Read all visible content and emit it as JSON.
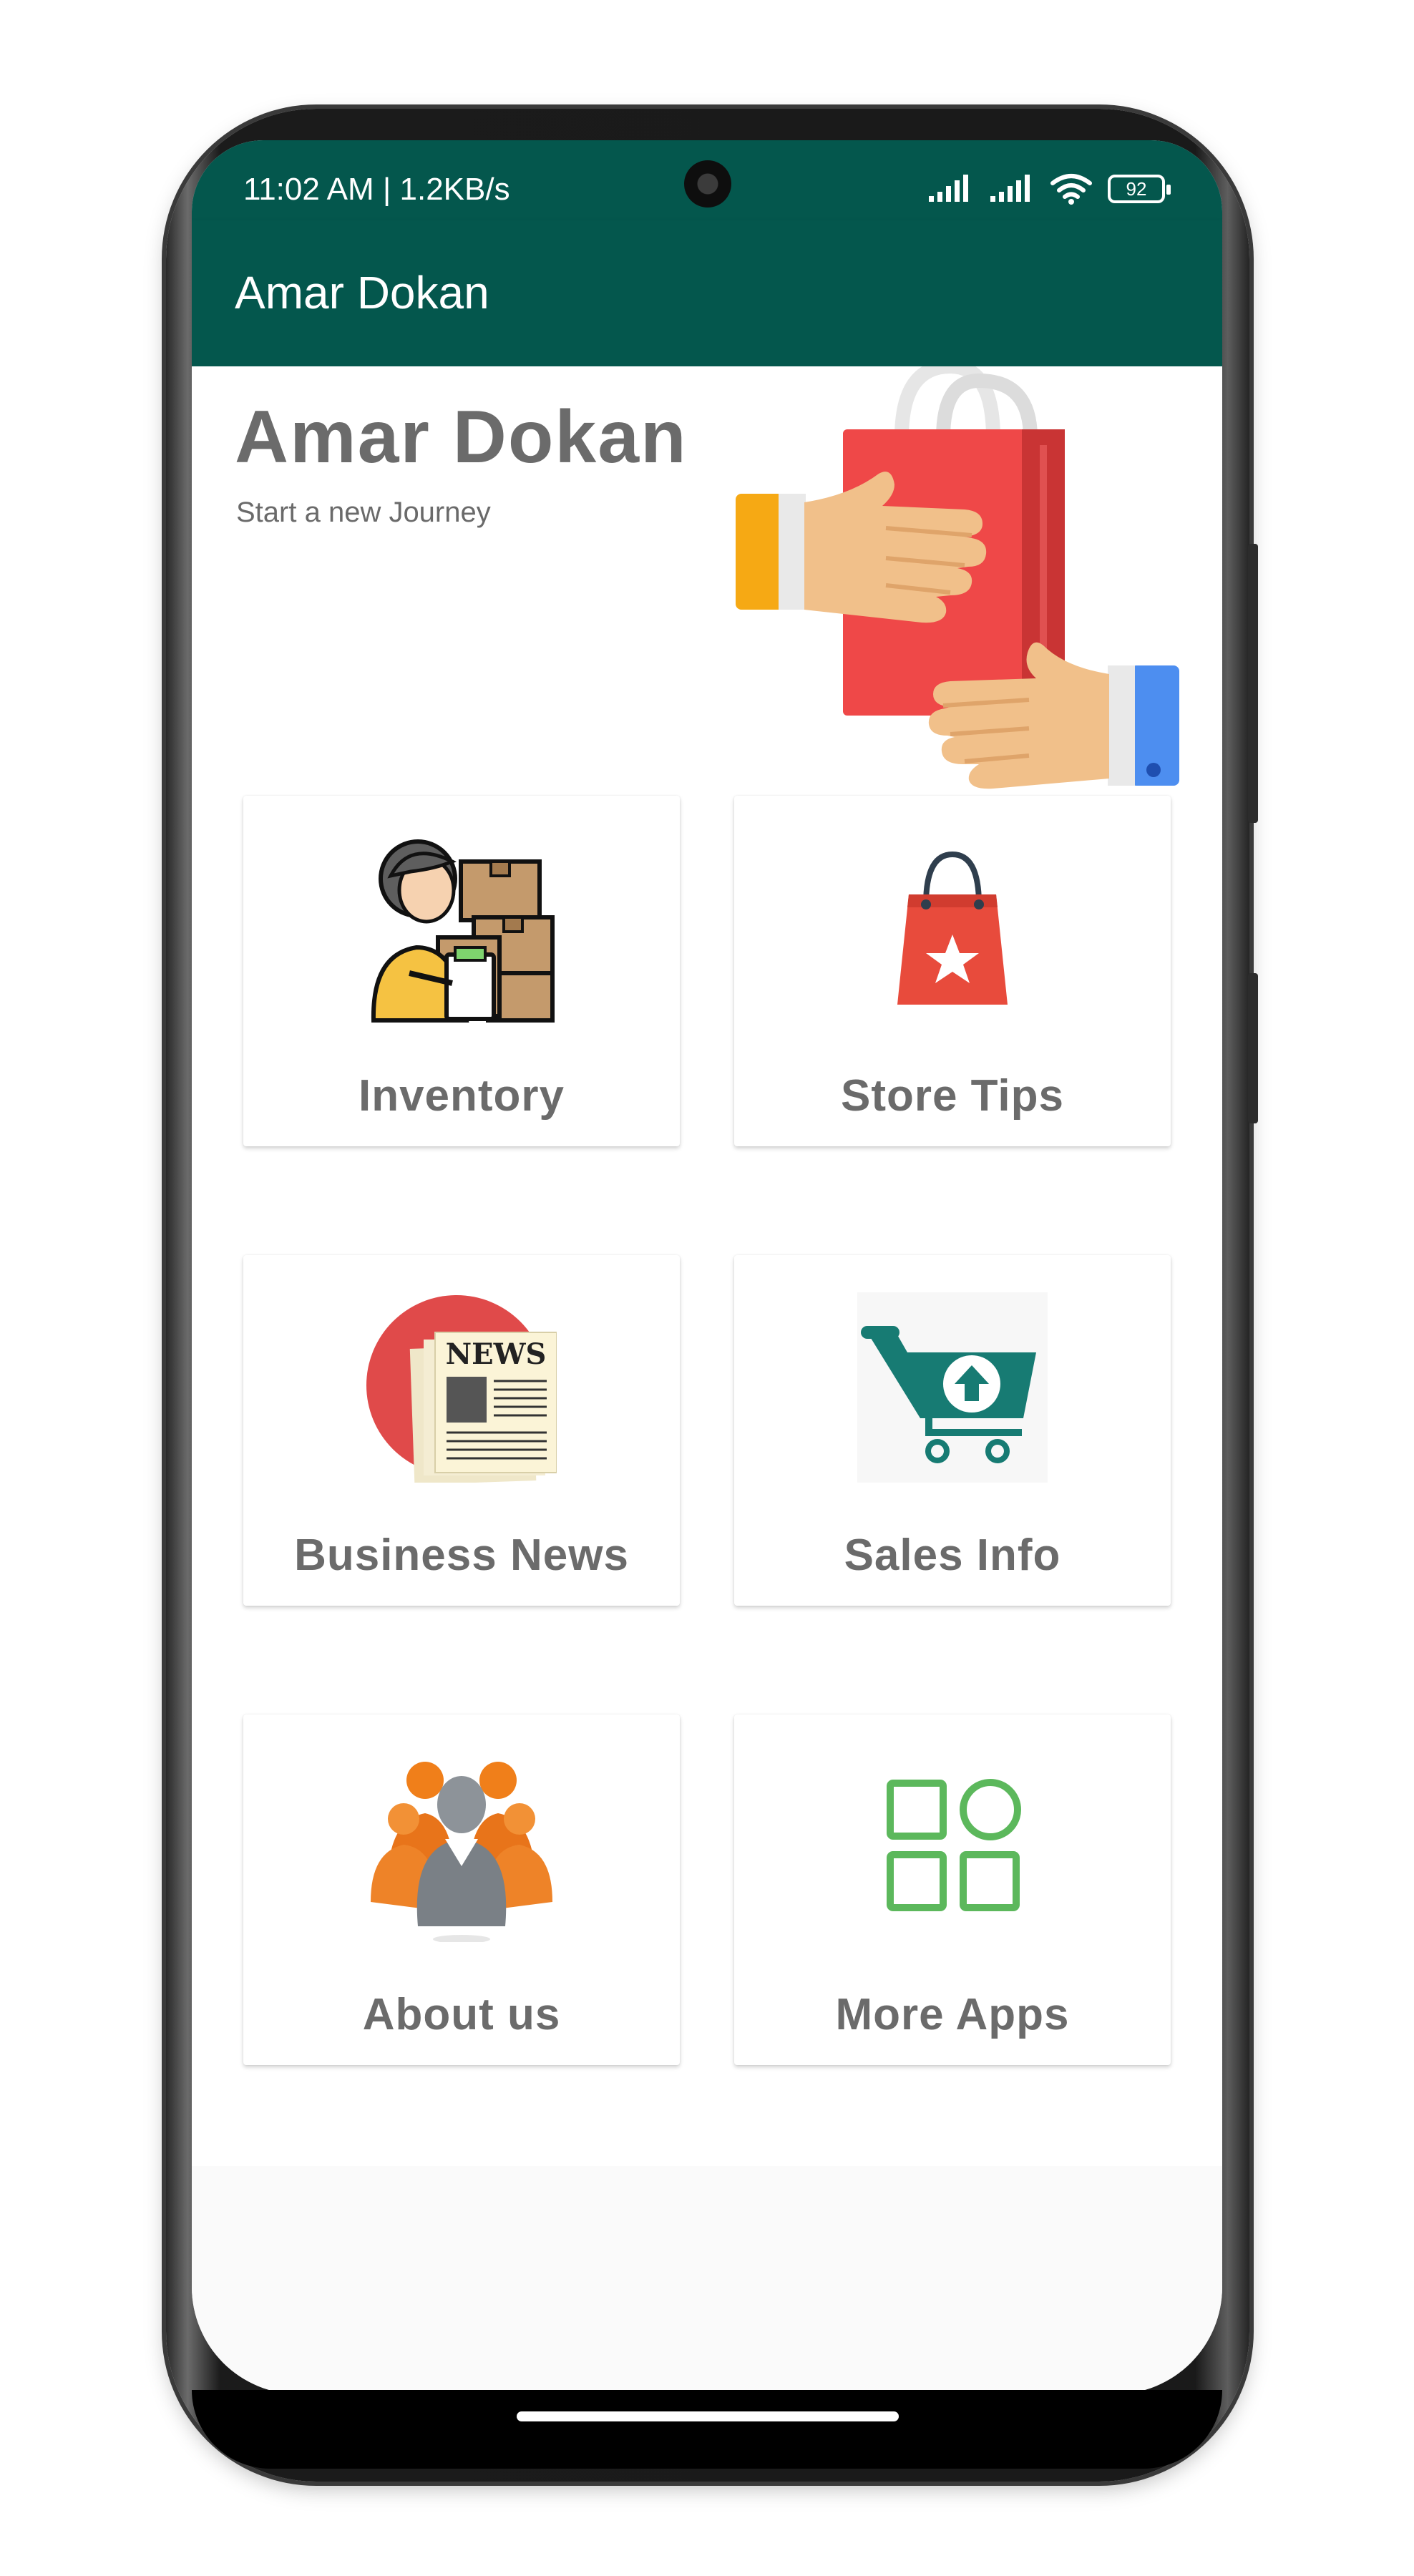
{
  "status_bar": {
    "time": "11:02 AM | 1.2KB/s",
    "battery": "92"
  },
  "app_bar": {
    "title": "Amar Dokan"
  },
  "hero": {
    "title": "Amar Dokan",
    "subtitle": "Start a new Journey",
    "art_icon": "shopping-bag-handover-icon"
  },
  "menu": [
    {
      "label": "Inventory",
      "icon": "inventory-person-boxes-icon"
    },
    {
      "label": "Store Tips",
      "icon": "shopping-bag-star-icon"
    },
    {
      "label": "Business News",
      "icon": "newspaper-icon"
    },
    {
      "label": "Sales Info",
      "icon": "shopping-cart-upload-icon"
    },
    {
      "label": "About us",
      "icon": "people-group-icon"
    },
    {
      "label": "More Apps",
      "icon": "apps-grid-icon"
    }
  ],
  "colors": {
    "primary": "#04574d",
    "label_gray": "#6b6b6b",
    "apps_green": "#5cb85c",
    "cart_teal": "#177b73"
  }
}
